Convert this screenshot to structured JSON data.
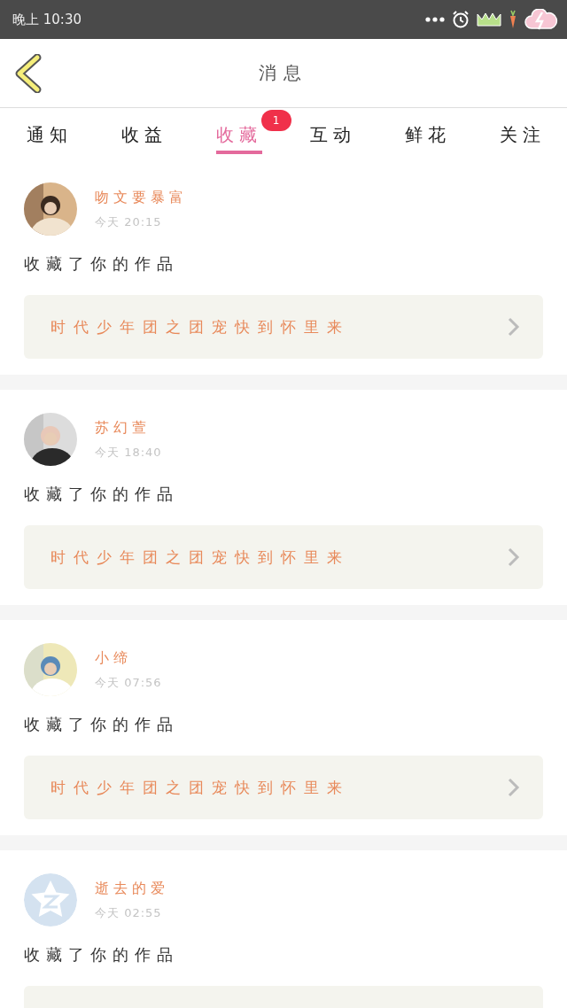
{
  "status_bar": {
    "time": "晚上 10:30"
  },
  "header": {
    "title": "消息"
  },
  "tabs": [
    {
      "label": "通知",
      "selected": false
    },
    {
      "label": "收益",
      "selected": false
    },
    {
      "label": "收藏",
      "selected": true,
      "badge": "1"
    },
    {
      "label": "互动",
      "selected": false
    },
    {
      "label": "鲜花",
      "selected": false
    },
    {
      "label": "关注",
      "selected": false
    }
  ],
  "messages": [
    {
      "name": "吻文要暴富",
      "time": "今天 20:15",
      "action": "收藏了你的作品",
      "work": "时代少年团之团宠快到怀里来"
    },
    {
      "name": "苏幻萱",
      "time": "今天 18:40",
      "action": "收藏了你的作品",
      "work": "时代少年团之团宠快到怀里来"
    },
    {
      "name": "小缔",
      "time": "今天 07:56",
      "action": "收藏了你的作品",
      "work": "时代少年团之团宠快到怀里来"
    },
    {
      "avatar": {
        "kind": "default"
      },
      "name": "逝去的爱",
      "time": "今天 02:55",
      "action": "收藏了你的作品"
    }
  ]
}
